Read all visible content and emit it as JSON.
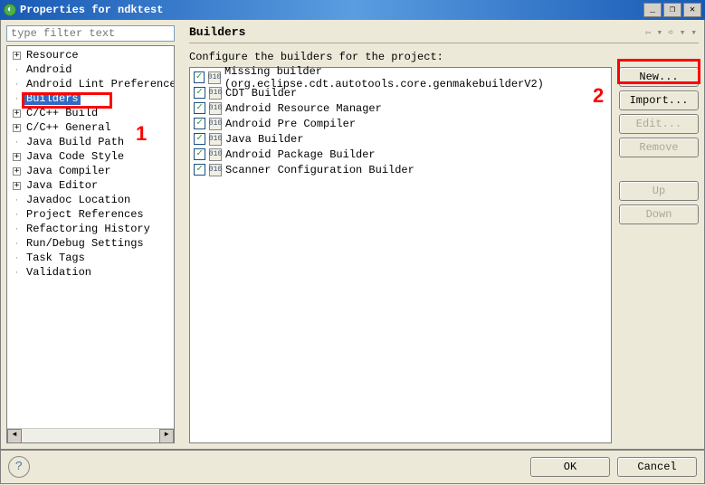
{
  "window": {
    "title": "Properties for ndktest",
    "min_label": "_",
    "max_label": "❒",
    "close_label": "✕"
  },
  "filter": {
    "placeholder": "type filter text"
  },
  "tree": [
    {
      "label": "Resource",
      "expandable": true,
      "indent": 0
    },
    {
      "label": "Android",
      "expandable": false,
      "indent": 0
    },
    {
      "label": "Android Lint Preferences",
      "expandable": false,
      "indent": 0
    },
    {
      "label": "Builders",
      "expandable": false,
      "indent": 0,
      "selected": true
    },
    {
      "label": "C/C++ Build",
      "expandable": true,
      "indent": 0
    },
    {
      "label": "C/C++ General",
      "expandable": true,
      "indent": 0
    },
    {
      "label": "Java Build Path",
      "expandable": false,
      "indent": 0
    },
    {
      "label": "Java Code Style",
      "expandable": true,
      "indent": 0
    },
    {
      "label": "Java Compiler",
      "expandable": true,
      "indent": 0
    },
    {
      "label": "Java Editor",
      "expandable": true,
      "indent": 0
    },
    {
      "label": "Javadoc Location",
      "expandable": false,
      "indent": 0
    },
    {
      "label": "Project References",
      "expandable": false,
      "indent": 0
    },
    {
      "label": "Refactoring History",
      "expandable": false,
      "indent": 0
    },
    {
      "label": "Run/Debug Settings",
      "expandable": false,
      "indent": 0
    },
    {
      "label": "Task Tags",
      "expandable": false,
      "indent": 0
    },
    {
      "label": "Validation",
      "expandable": false,
      "indent": 0
    }
  ],
  "page": {
    "title": "Builders",
    "description": "Configure the builders for the project:"
  },
  "builders": [
    {
      "checked": true,
      "label": "Missing builder (org.eclipse.cdt.autotools.core.genmakebuilderV2)",
      "icon": "010"
    },
    {
      "checked": true,
      "label": "CDT Builder",
      "icon": "010"
    },
    {
      "checked": true,
      "label": "Android Resource Manager",
      "icon": "010"
    },
    {
      "checked": true,
      "label": "Android Pre Compiler",
      "icon": "010"
    },
    {
      "checked": true,
      "label": "Java Builder",
      "icon": "010"
    },
    {
      "checked": true,
      "label": "Android Package Builder",
      "icon": "010"
    },
    {
      "checked": true,
      "label": "Scanner Configuration Builder",
      "icon": "010"
    }
  ],
  "buttons": {
    "new": "New...",
    "import": "Import...",
    "edit": "Edit...",
    "remove": "Remove",
    "up": "Up",
    "down": "Down",
    "ok": "OK",
    "cancel": "Cancel"
  },
  "annotations": {
    "one": "1",
    "two": "2"
  },
  "nav": {
    "back": "⇦",
    "fwd": "➪",
    "menu": "▾"
  }
}
